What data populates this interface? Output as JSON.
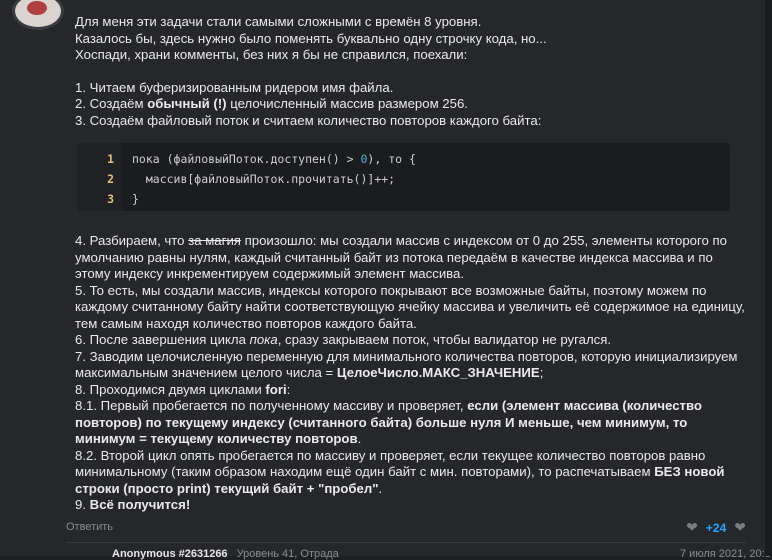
{
  "comment": {
    "intro": [
      "Для меня эти задачи стали самыми сложными с времён 8 уровня.",
      "Казалось бы, здесь нужно было поменять буквально одну строчку кода, но...",
      "Хоспади, храни комменты, без них я бы не справился, поехали:"
    ],
    "step1": "1. Читаем буферизированным ридером имя файла.",
    "step2_pre": "2. Создаём ",
    "step2_bold": "обычный (!)",
    "step2_post": " целочисленный массив размером 256.",
    "step3": "3. Создаём файловый поток и считаем количество повторов каждого байта:",
    "code": {
      "line_numbers": [
        "1",
        "2",
        "3"
      ],
      "line1_pre": "пока (файловыйПоток.доступен() > ",
      "line1_num": "0",
      "line1_post": "), то {",
      "line2": "  массив[файловыйПоток.прочитать()]++;",
      "line3": "}"
    },
    "step4_pre": "4. Разбираем, что ",
    "step4_strike": "за магия",
    "step4_post": " произошло: мы создали массив с индексом от 0 до 255, элементы которого по умолчанию равны нулям, каждый считанный байт из потока передаём в качестве индекса массива и по этому индексу инкрементируем содержимый элемент массива.",
    "step5": "5. То есть, мы создали массив, индексы которого покрывают все возможные байты, поэтому можем по каждому считанному байту найти соответствующую ячейку массива и увеличить её содержимое на единицу, тем самым находя количество повторов каждого байта.",
    "step6_pre": "6. После завершения цикла ",
    "step6_italic": "пока",
    "step6_post": ", сразу закрываем поток, чтобы валидатор не ругался.",
    "step7_pre": "7. Заводим целочисленную переменную для минимального количества повторов, которую инициализируем максимальным значением целого числа = ",
    "step7_bold": "ЦелоеЧисло.МАКС_ЗНАЧЕНИЕ",
    "step7_post": ";",
    "step8_pre": "8. Проходимся двумя циклами ",
    "step8_bold": "fori",
    "step8_post": ":",
    "step81_pre": "8.1. Первый пробегается по полученному массиву и проверяет, ",
    "step81_bold": "если (элемент массива (количество повторов) по текущему индексу (считанного байта) больше нуля И меньше, чем минимум, то минимум = текущему количеству повторов",
    "step81_post": ".",
    "step82_pre": "8.2. Второй цикл опять пробегается по массиву и проверяет, если текущее количество повторов равно минимальному (таким образом находим ещё один байт с мин. повторами), то распечатываем ",
    "step82_bold": "БЕЗ новой строки (просто print) текущий байт + \"пробел\"",
    "step82_post": ".",
    "step9_pre": "9. ",
    "step9_bold": "Всё получится!"
  },
  "actions": {
    "reply_label": "Ответить",
    "vote_count": "+24"
  },
  "next_comment": {
    "author": "Anonymous #2631266",
    "meta": "Уровень 41, Отрада",
    "date": "7 июля 2021, 20:30"
  }
}
